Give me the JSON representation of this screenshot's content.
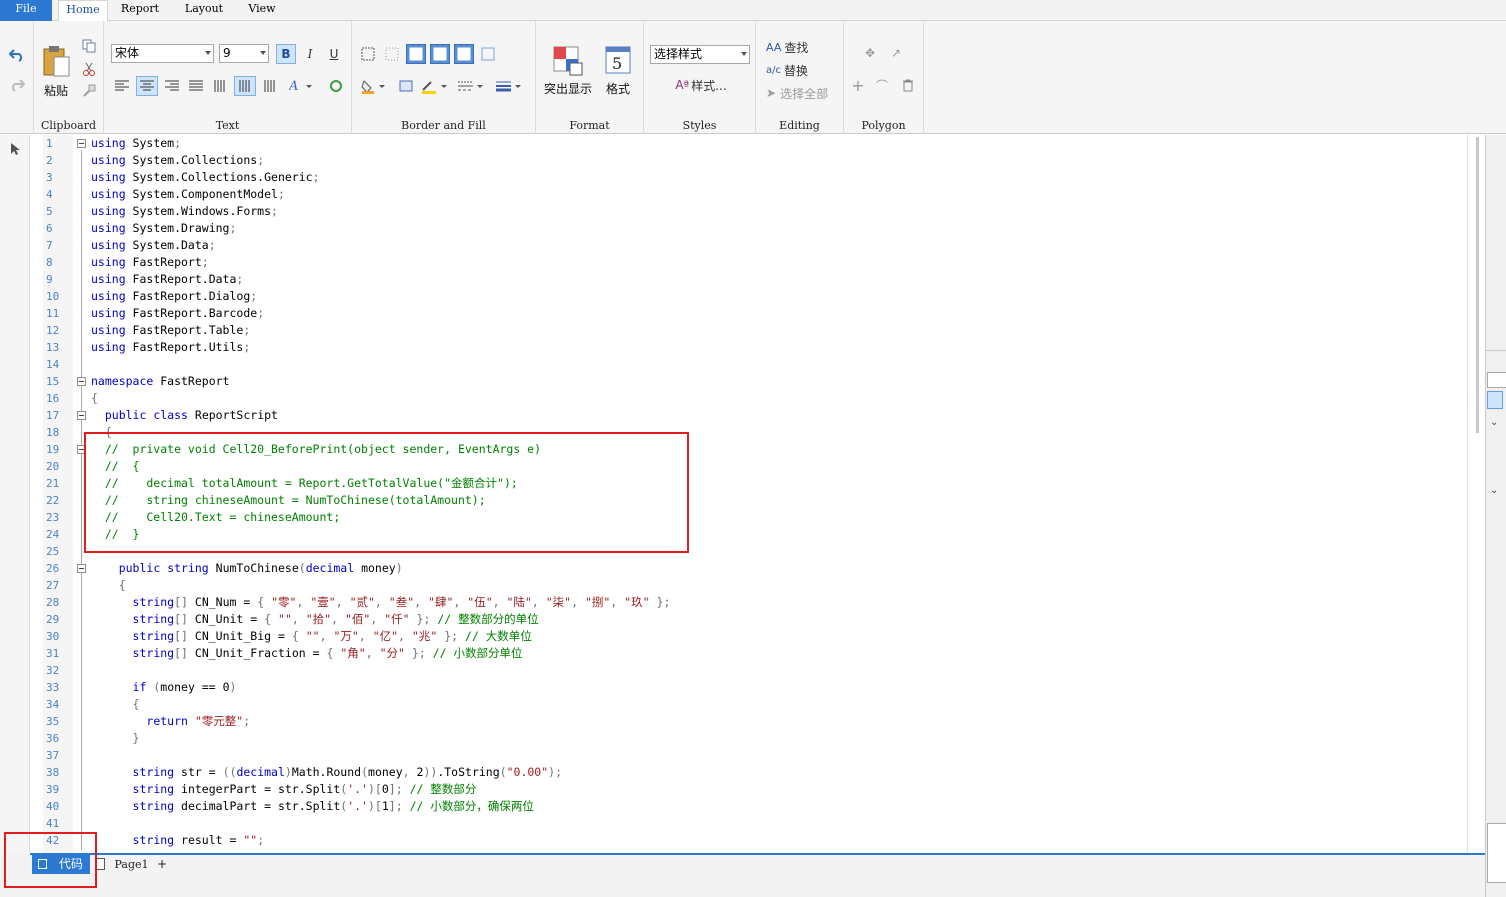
{
  "menu": {
    "file": "File",
    "home": "Home",
    "report": "Report",
    "layout": "Layout",
    "view": "View"
  },
  "ribbon": {
    "clipboard": {
      "label": "Clipboard",
      "paste": "粘贴"
    },
    "text": {
      "label": "Text",
      "font_name": "宋体",
      "font_size": "9",
      "bold": "B",
      "italic": "I",
      "underline": "U"
    },
    "border_fill": {
      "label": "Border and Fill"
    },
    "format": {
      "label": "Format",
      "highlight": "突出显示",
      "format": "格式"
    },
    "styles": {
      "label": "Styles",
      "select_style": "选择样式",
      "style_btn": "样式..."
    },
    "editing": {
      "label": "Editing",
      "find": "查找",
      "replace": "替换",
      "select_all": "选择全部"
    },
    "polygon": {
      "label": "Polygon"
    }
  },
  "editor": {
    "line_numbers": [
      "1",
      "2",
      "3",
      "4",
      "5",
      "6",
      "7",
      "8",
      "9",
      "10",
      "11",
      "12",
      "13",
      "14",
      "15",
      "16",
      "17",
      "18",
      "19",
      "20",
      "21",
      "22",
      "23",
      "24",
      "25",
      "26",
      "27",
      "28",
      "29",
      "30",
      "31",
      "32",
      "33",
      "34",
      "35",
      "36",
      "37",
      "38",
      "39",
      "40",
      "41",
      "42"
    ],
    "lines": [
      "using System;",
      "using System.Collections;",
      "using System.Collections.Generic;",
      "using System.ComponentModel;",
      "using System.Windows.Forms;",
      "using System.Drawing;",
      "using System.Data;",
      "using FastReport;",
      "using FastReport.Data;",
      "using FastReport.Dialog;",
      "using FastReport.Barcode;",
      "using FastReport.Table;",
      "using FastReport.Utils;",
      "",
      "namespace FastReport",
      "{",
      "  public class ReportScript",
      "  {",
      "  //  private void Cell20_BeforePrint(object sender, EventArgs e)",
      "  //  {",
      "  //    decimal totalAmount = Report.GetTotalValue(\"金额合计\");",
      "  //    string chineseAmount = NumToChinese(totalAmount);",
      "  //    Cell20.Text = chineseAmount;",
      "  //  }",
      "",
      "    public string NumToChinese(decimal money)",
      "    {",
      "      string[] CN_Num = { \"零\", \"壹\", \"贰\", \"叁\", \"肆\", \"伍\", \"陆\", \"柒\", \"捌\", \"玖\" };",
      "      string[] CN_Unit = { \"\", \"拾\", \"佰\", \"仟\" }; // 整数部分的单位",
      "      string[] CN_Unit_Big = { \"\", \"万\", \"亿\", \"兆\" }; // 大数单位",
      "      string[] CN_Unit_Fraction = { \"角\", \"分\" }; // 小数部分单位",
      "",
      "      if (money == 0)",
      "      {",
      "        return \"零元整\";",
      "      }",
      "",
      "      string str = ((decimal)Math.Round(money, 2)).ToString(\"0.00\");",
      "      string integerPart = str.Split('.')[0]; // 整数部分",
      "      string decimalPart = str.Split('.')[1]; // 小数部分，确保两位",
      "",
      "      string result = \"\";"
    ]
  },
  "bottom": {
    "code_tab": "代码",
    "page_tab": "Page1",
    "add_tab": "+"
  },
  "colors": {
    "accent": "#2b79d1",
    "keyword": "#0000c8",
    "comment": "#008000",
    "string": "#9a1b1b",
    "highlight_box": "#e01e1e"
  }
}
